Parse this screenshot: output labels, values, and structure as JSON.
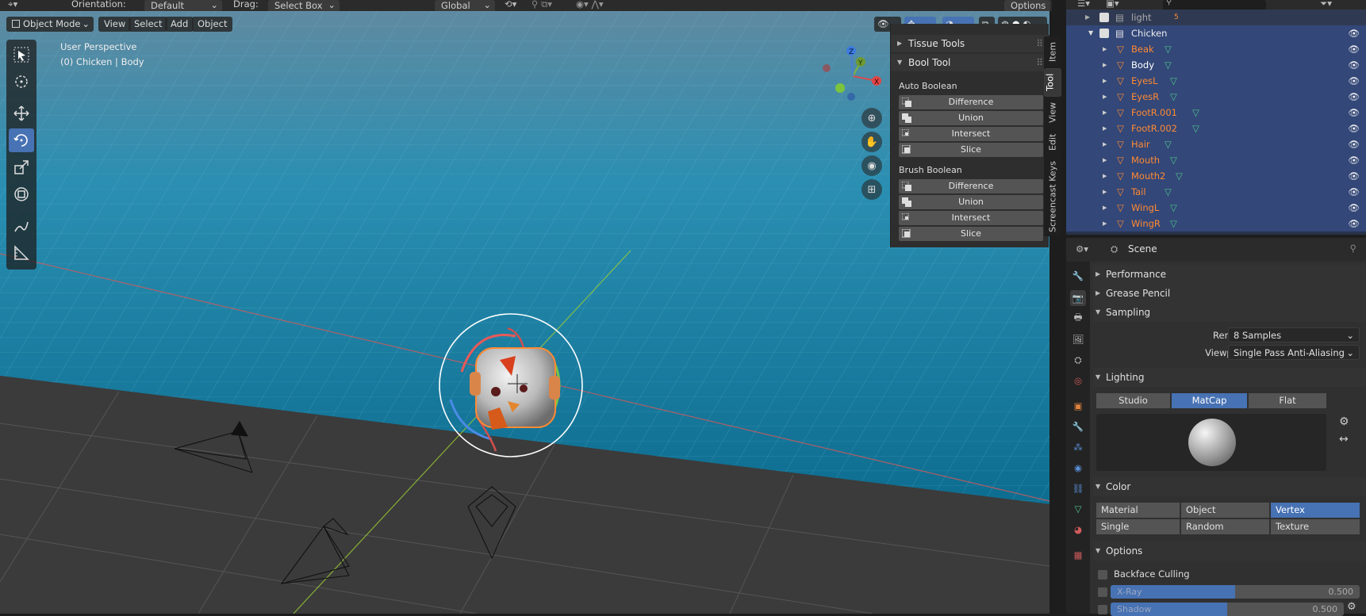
{
  "topbar": {
    "orientation_label": "Orientation:",
    "orientation_value": "Default",
    "drag_label": "Drag:",
    "drag_value": "Select Box",
    "transform_space": "Global",
    "options": "Options"
  },
  "viewport_header": {
    "mode": "Object Mode",
    "menus": [
      "View",
      "Select",
      "Add",
      "Object"
    ]
  },
  "overlay": {
    "perspective": "User Perspective",
    "active": "(0) Chicken | Body"
  },
  "gizmo": {
    "x": "X",
    "y": "Y",
    "z": "Z"
  },
  "npanel": {
    "tissue_tools": "Tissue Tools",
    "bool_tool": "Bool Tool",
    "auto_boolean": "Auto Boolean",
    "auto_items": [
      "Difference",
      "Union",
      "Intersect",
      "Slice"
    ],
    "brush_boolean": "Brush Boolean",
    "brush_items": [
      "Difference",
      "Union",
      "Intersect",
      "Slice"
    ],
    "tabs": [
      "Item",
      "Tool",
      "View",
      "Edit",
      "Screencast Keys"
    ]
  },
  "outliner": {
    "top_item": "light",
    "top_badge": "5",
    "collection": "Chicken",
    "children": [
      "Beak",
      "Body",
      "EyesL",
      "EyesR",
      "FootR.001",
      "FootR.002",
      "Hair",
      "Mouth",
      "Mouth2",
      "Tail",
      "WingL",
      "WingR"
    ]
  },
  "properties": {
    "context": "Scene",
    "performance": "Performance",
    "grease_pencil": "Grease Pencil",
    "sampling": "Sampling",
    "render_label": "Render",
    "render_value": "8 Samples",
    "viewport_label": "Viewport",
    "viewport_value": "Single Pass Anti-Aliasing",
    "lighting": "Lighting",
    "lighting_modes": [
      "Studio",
      "MatCap",
      "Flat"
    ],
    "lighting_selected": "MatCap",
    "color": "Color",
    "color_row1": [
      "Material",
      "Object",
      "Vertex"
    ],
    "color_row2": [
      "Single",
      "Random",
      "Texture"
    ],
    "color_selected": "Vertex",
    "options": "Options",
    "backface": "Backface Culling",
    "xray_label": "X-Ray",
    "xray_value": "0.500",
    "xray_fraction": 0.5,
    "shadow_label": "Shadow",
    "shadow_value": "0.500"
  },
  "colors": {
    "accent": "#4772b3",
    "object_orange": "#ff8a33",
    "outliner_bg": "#28334a",
    "viewport_floor": "#1b7fa0"
  }
}
